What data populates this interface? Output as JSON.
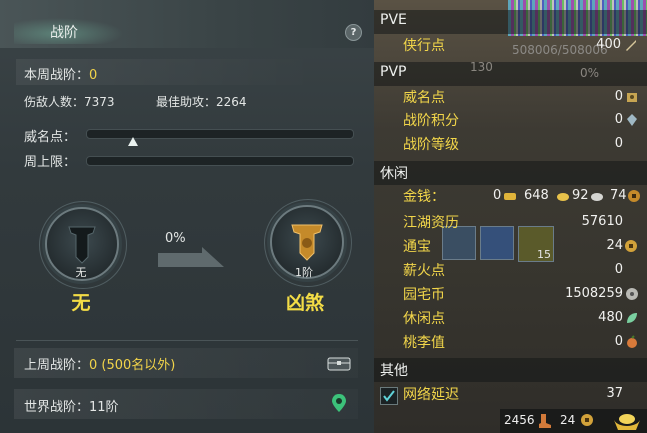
{
  "left": {
    "title": "战阶",
    "help": "?",
    "weekly_rank_label": "本周战阶：",
    "weekly_rank_value": "0",
    "defeated_label": "伤敌人数：",
    "defeated_value": "7373",
    "best_assist_label": "最佳助攻：",
    "best_assist_value": "2264",
    "prestige_label": "威名点：",
    "weekly_cap_label": "周上限：",
    "progress_pct": "0%",
    "current_medal_level": "无",
    "current_medal_name": "无",
    "next_medal_level": "1阶",
    "next_medal_name": "凶煞",
    "last_week_label": "上周战阶：",
    "last_week_value": "0 (500名以外)",
    "world_rank_label": "世界战阶：",
    "world_rank_value": "11阶"
  },
  "right": {
    "top_value": "508006/508006",
    "sections": {
      "pve": "PVE",
      "pvp": "PVP",
      "leisure": "休闲",
      "other": "其他"
    },
    "pve_items": [
      {
        "label": "侠行点",
        "value": "400"
      }
    ],
    "pvp_overlay_num": "130",
    "pvp_overlay_pct": "0%",
    "pvp_items": [
      {
        "label": "威名点",
        "value": "0"
      },
      {
        "label": "战阶积分",
        "value": "0"
      },
      {
        "label": "战阶等级",
        "value": "0"
      }
    ],
    "money_label": "金钱：",
    "money": {
      "gold": "0",
      "silver_a": "648",
      "silver_b": "92",
      "copper": "74"
    },
    "leisure_items": [
      {
        "label": "江湖资历",
        "value": "57610"
      },
      {
        "label": "通宝",
        "value": "24"
      },
      {
        "label": "薪火点",
        "value": "0"
      },
      {
        "label": "园宅币",
        "value": "1508259"
      },
      {
        "label": "休闲点",
        "value": "480"
      },
      {
        "label": "桃李值",
        "value": "0"
      }
    ],
    "skill_badge": "15",
    "other_items": [
      {
        "label": "网络延迟",
        "value": "37"
      }
    ],
    "bottom": {
      "count_a": "2456",
      "count_b": "24"
    },
    "colors": {
      "label": "#f2d64a",
      "accent_gold": "#f3dc46"
    }
  }
}
